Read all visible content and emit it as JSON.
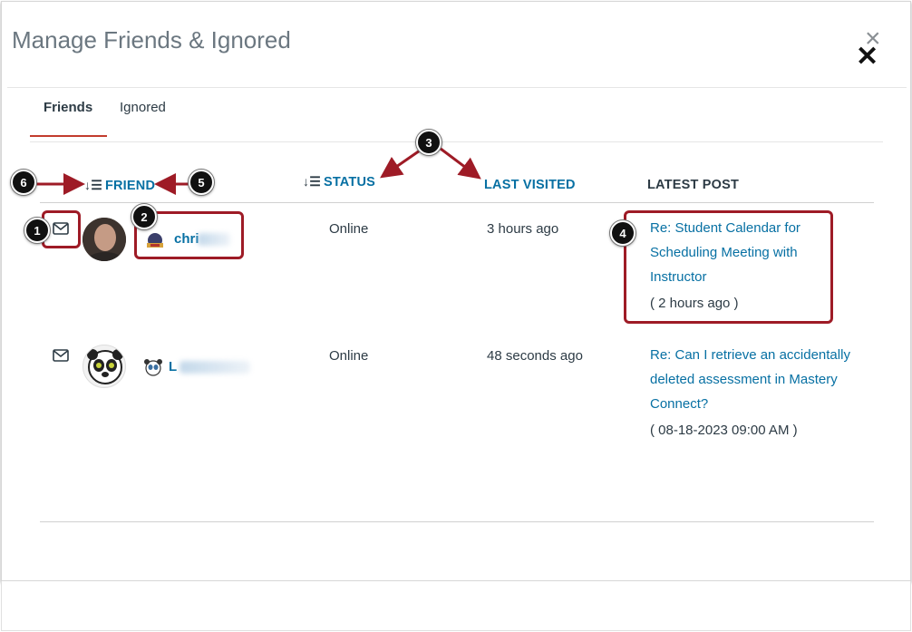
{
  "dialog": {
    "title": "Manage Friends & Ignored",
    "close_icon": "close-icon"
  },
  "tabs": [
    {
      "label": "Friends",
      "active": true
    },
    {
      "label": "Ignored",
      "active": false
    }
  ],
  "columns": {
    "friend": "FRIEND",
    "status": "STATUS",
    "last_visited": "LAST VISITED",
    "latest_post": "LATEST POST"
  },
  "rows": [
    {
      "name": "chri",
      "status": "Online",
      "last_visited": "3 hours ago",
      "post_lines": [
        "Re: Student Calendar for",
        "Scheduling Meeting with",
        "Instructor"
      ],
      "post_time": "( 2 hours ago )"
    },
    {
      "name": "L",
      "status": "Online",
      "last_visited": "48 seconds ago",
      "post_lines": [
        "Re: Can I retrieve an accidentally",
        "deleted assessment in Mastery",
        "Connect?"
      ],
      "post_time": "( 08-18-2023 09:00 AM )"
    }
  ],
  "markers": [
    "1",
    "2",
    "3",
    "4",
    "5",
    "6"
  ],
  "colors": {
    "accent_link": "#0770a3",
    "tab_underline": "#c23c2d",
    "annotation": "#9e1b26"
  }
}
